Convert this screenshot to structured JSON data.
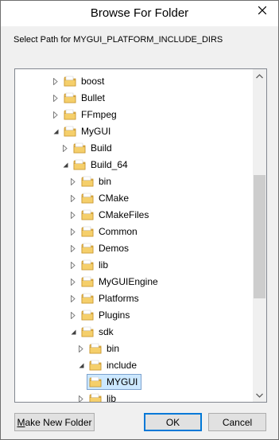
{
  "window": {
    "title": "Browse For Folder",
    "prompt": "Select Path for MYGUI_PLATFORM_INCLUDE_DIRS"
  },
  "tree": {
    "items": [
      {
        "label": "boost",
        "expanded": false,
        "selected": false
      },
      {
        "label": "Bullet",
        "expanded": false,
        "selected": false
      },
      {
        "label": "FFmpeg",
        "expanded": false,
        "selected": false
      },
      {
        "label": "MyGUI",
        "expanded": true,
        "selected": false
      },
      {
        "label": "Build",
        "expanded": false,
        "selected": false
      },
      {
        "label": "Build_64",
        "expanded": true,
        "selected": false
      },
      {
        "label": "bin",
        "expanded": false,
        "selected": false
      },
      {
        "label": "CMake",
        "expanded": false,
        "selected": false
      },
      {
        "label": "CMakeFiles",
        "expanded": false,
        "selected": false
      },
      {
        "label": "Common",
        "expanded": false,
        "selected": false
      },
      {
        "label": "Demos",
        "expanded": false,
        "selected": false
      },
      {
        "label": "lib",
        "expanded": false,
        "selected": false
      },
      {
        "label": "MyGUIEngine",
        "expanded": false,
        "selected": false
      },
      {
        "label": "Platforms",
        "expanded": false,
        "selected": false
      },
      {
        "label": "Plugins",
        "expanded": false,
        "selected": false
      },
      {
        "label": "sdk",
        "expanded": true,
        "selected": false
      },
      {
        "label": "bin",
        "expanded": false,
        "selected": false
      },
      {
        "label": "include",
        "expanded": true,
        "selected": false
      },
      {
        "label": "MYGUI",
        "expanded": false,
        "selected": true
      },
      {
        "label": "lib",
        "expanded": false,
        "selected": false
      }
    ]
  },
  "buttons": {
    "new_folder_first": "M",
    "new_folder_rest": "ake New Folder",
    "ok": "OK",
    "cancel": "Cancel"
  },
  "colors": {
    "folder": "#e8b64a",
    "selection": "#cce8ff",
    "accent": "#0078d7"
  }
}
